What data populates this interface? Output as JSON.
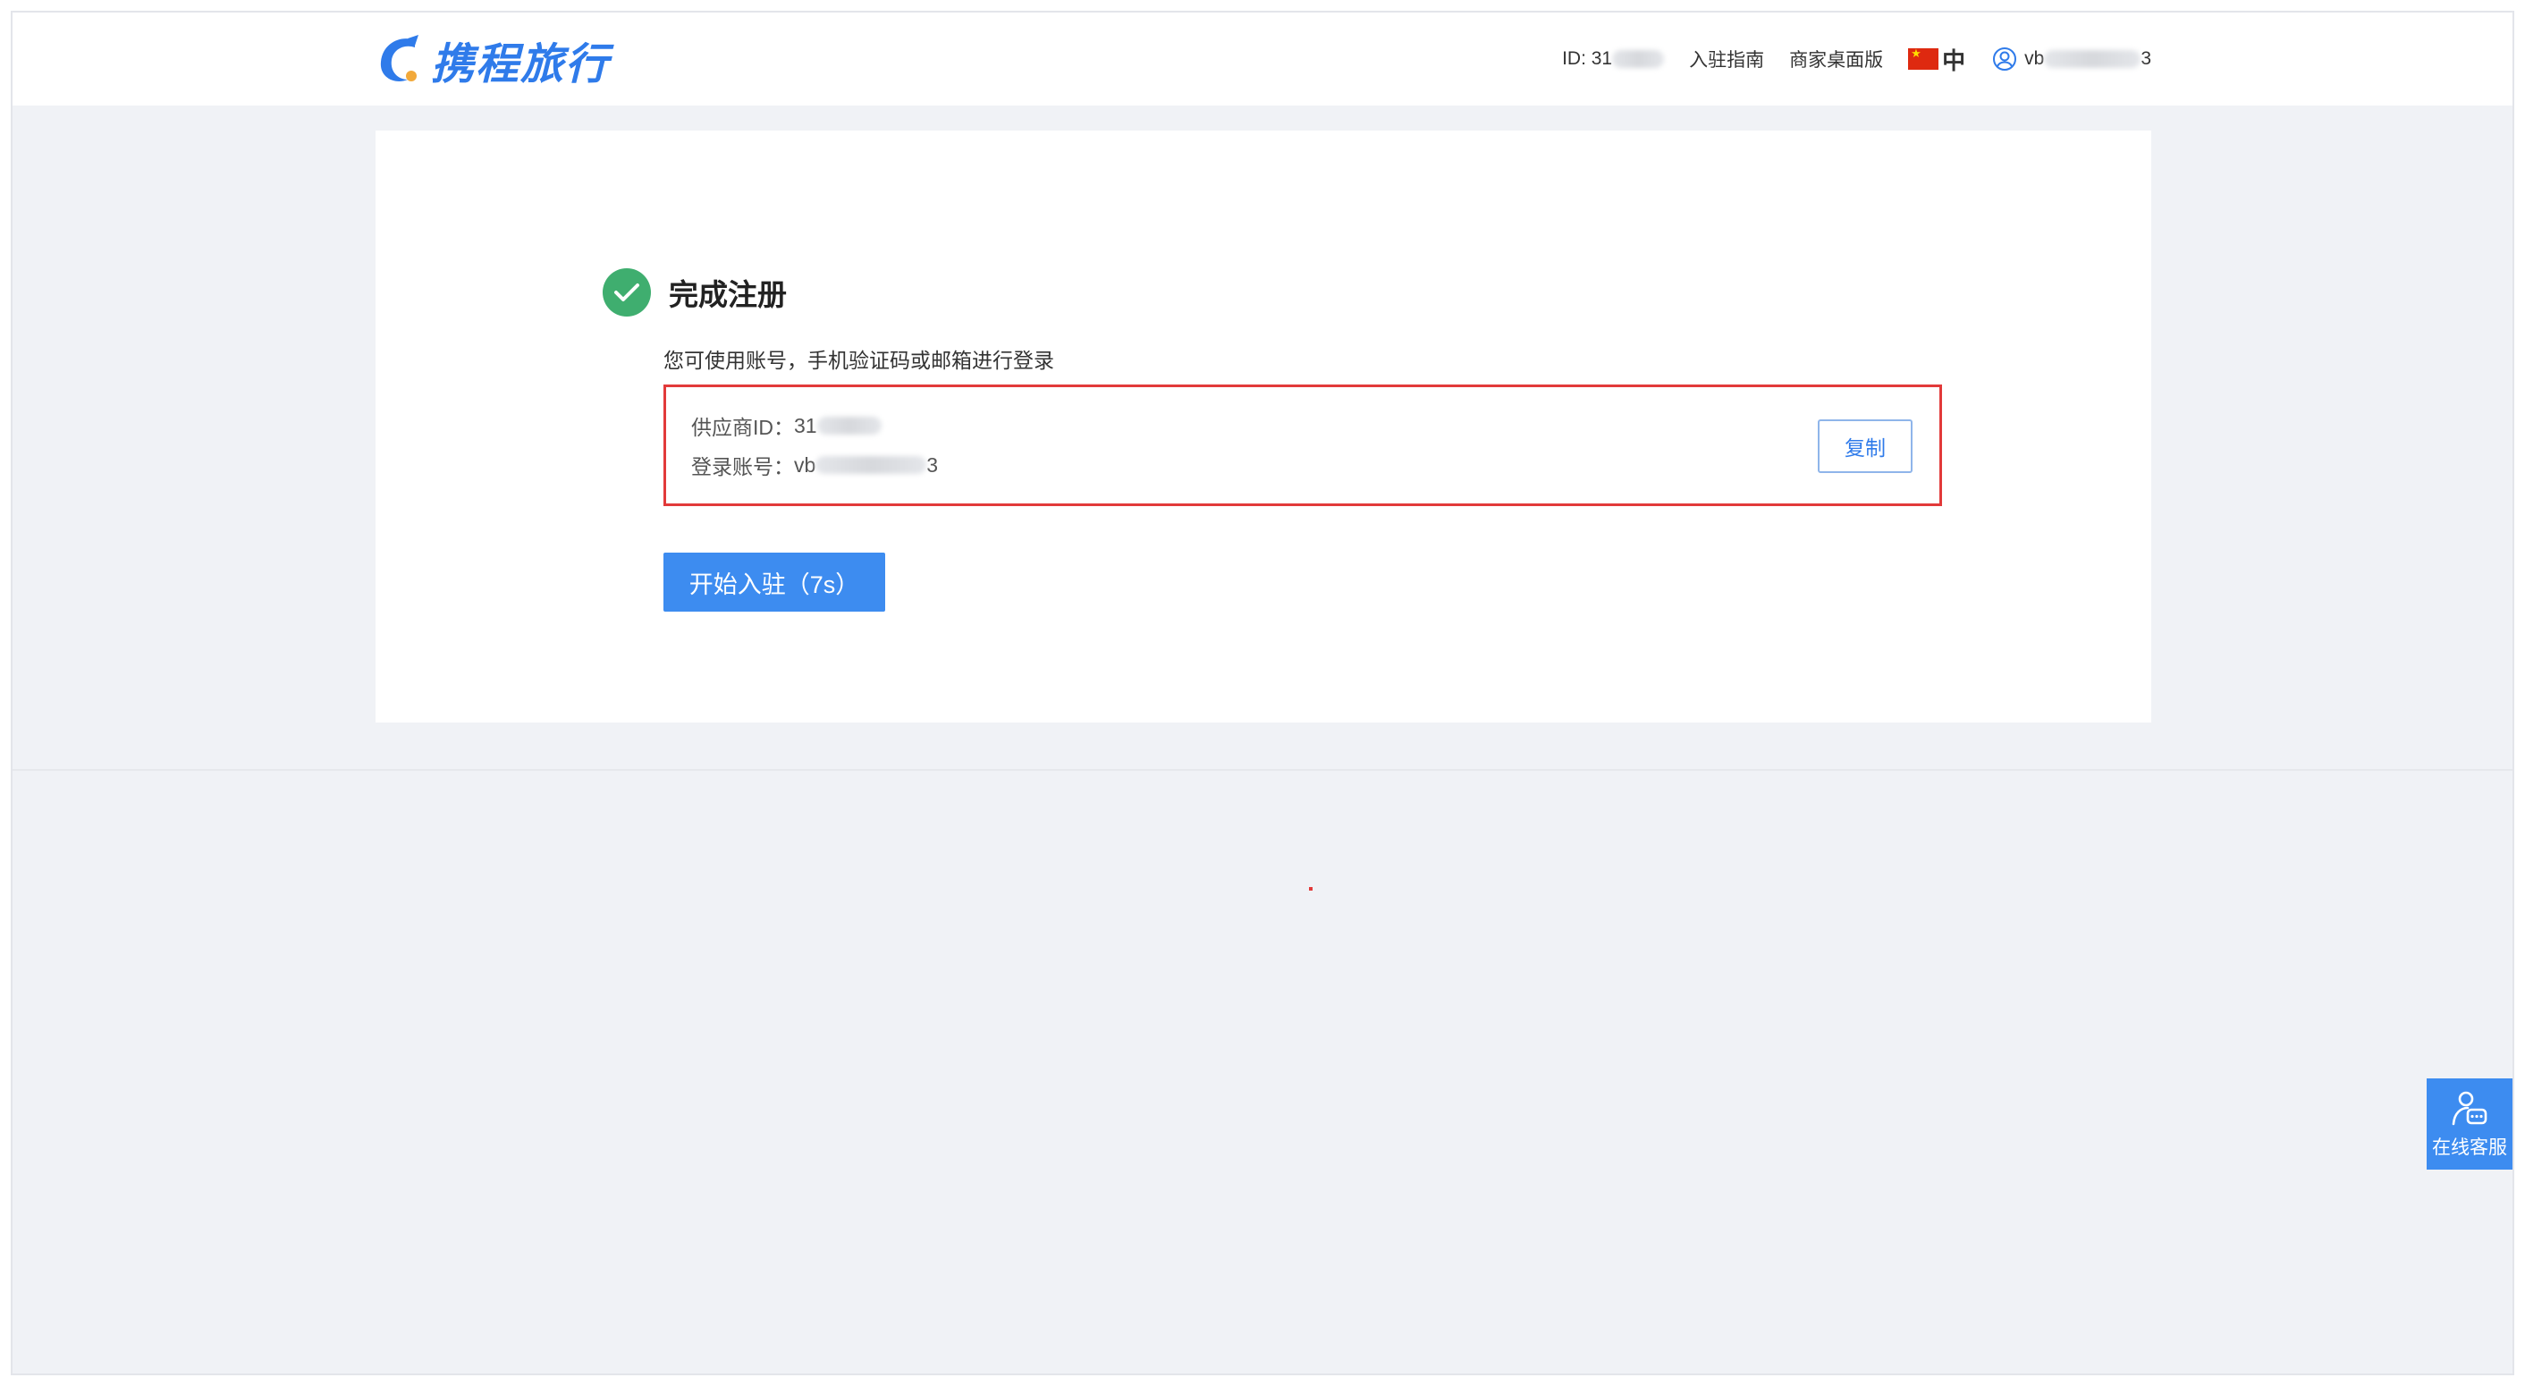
{
  "header": {
    "logo_text": "携程旅行",
    "id_label": "ID: 31",
    "nav_guide": "入驻指南",
    "nav_desktop": "商家桌面版",
    "lang_label": "中",
    "user_prefix": "vb",
    "user_suffix": "3"
  },
  "main": {
    "title": "完成注册",
    "hint": "您可使用账号，手机验证码或邮箱进行登录",
    "supplier_label": "供应商ID：",
    "supplier_value": "31",
    "account_label": "登录账号：",
    "account_prefix": "vb",
    "account_suffix": "3",
    "copy_label": "复制",
    "start_label": "开始入驻（7s）"
  },
  "service": {
    "label": "在线客服"
  },
  "colors": {
    "brand": "#2f7bea",
    "button": "#3d8cf0",
    "success": "#3fae6f",
    "highlight_border": "#e23a3a"
  }
}
